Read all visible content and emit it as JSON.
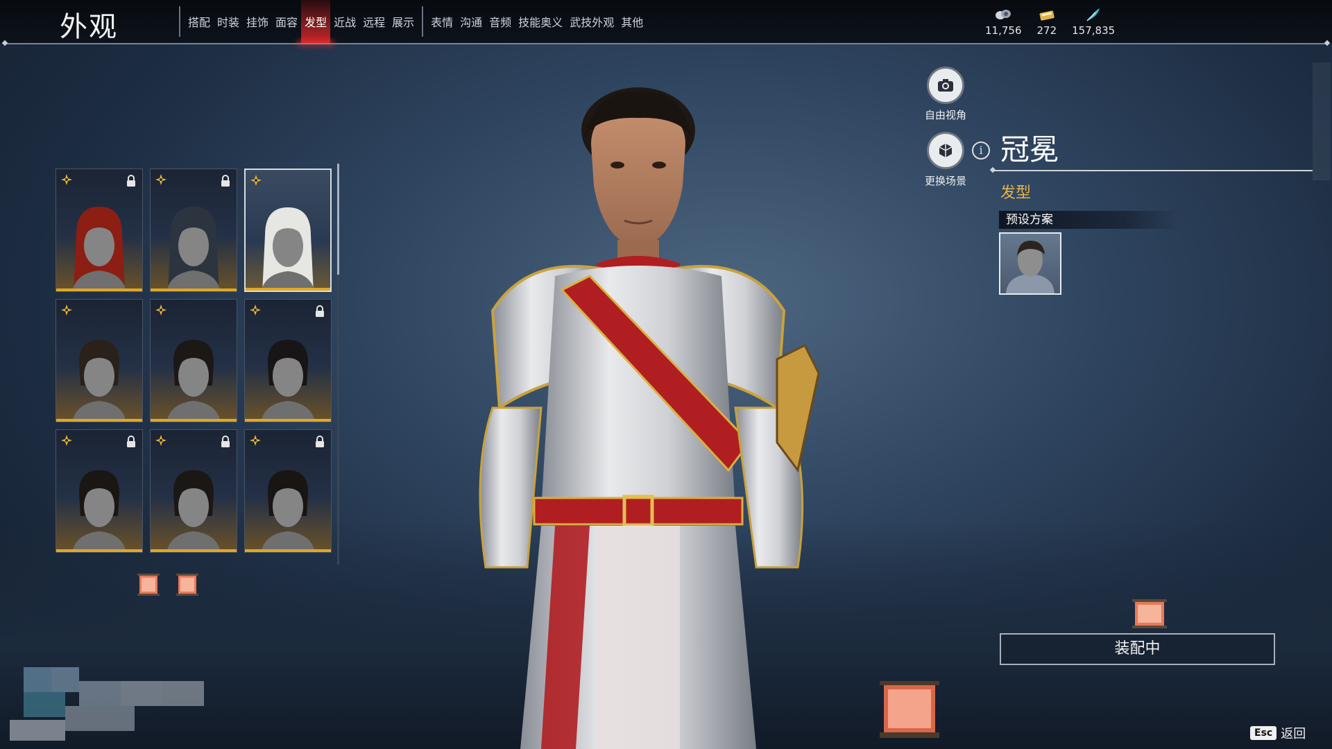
{
  "header": {
    "title": "外观",
    "tabs_group1": [
      "搭配",
      "时装",
      "挂饰",
      "面容",
      "发型",
      "近战",
      "远程",
      "展示"
    ],
    "tabs_group2": [
      "表情",
      "沟通",
      "音频",
      "技能奥义",
      "武技外观",
      "其他"
    ],
    "active_tab": "发型",
    "currencies": [
      {
        "icon": "coin-icon",
        "value": "11,756"
      },
      {
        "icon": "ticket-icon",
        "value": "272"
      },
      {
        "icon": "feather-icon",
        "value": "157,835"
      }
    ]
  },
  "hairstyle_grid": {
    "items": [
      {
        "hair": "red-long",
        "locked": true,
        "selected": false
      },
      {
        "hair": "silver-topknot",
        "locked": true,
        "selected": false
      },
      {
        "hair": "white-long",
        "locked": false,
        "selected": true
      },
      {
        "hair": "headband-bun",
        "locked": false,
        "selected": false
      },
      {
        "hair": "hairpin-bun",
        "locked": false,
        "selected": false
      },
      {
        "hair": "short-dark",
        "locked": true,
        "selected": false
      },
      {
        "hair": "loose-dark",
        "locked": true,
        "selected": false
      },
      {
        "hair": "crown-bun",
        "locked": true,
        "selected": false
      },
      {
        "hair": "tied-back",
        "locked": true,
        "selected": false
      }
    ]
  },
  "right_panel": {
    "free_camera_label": "自由视角",
    "change_scene_label": "更换场景",
    "item_name": "冠冕",
    "category": "发型",
    "preset_title": "预设方案",
    "equip_button": "装配中"
  },
  "footer": {
    "esc_key": "Esc",
    "esc_label": "返回"
  },
  "colors": {
    "accent_red": "#e02828",
    "gold": "#e0a826",
    "category_text": "#e9b44a"
  }
}
